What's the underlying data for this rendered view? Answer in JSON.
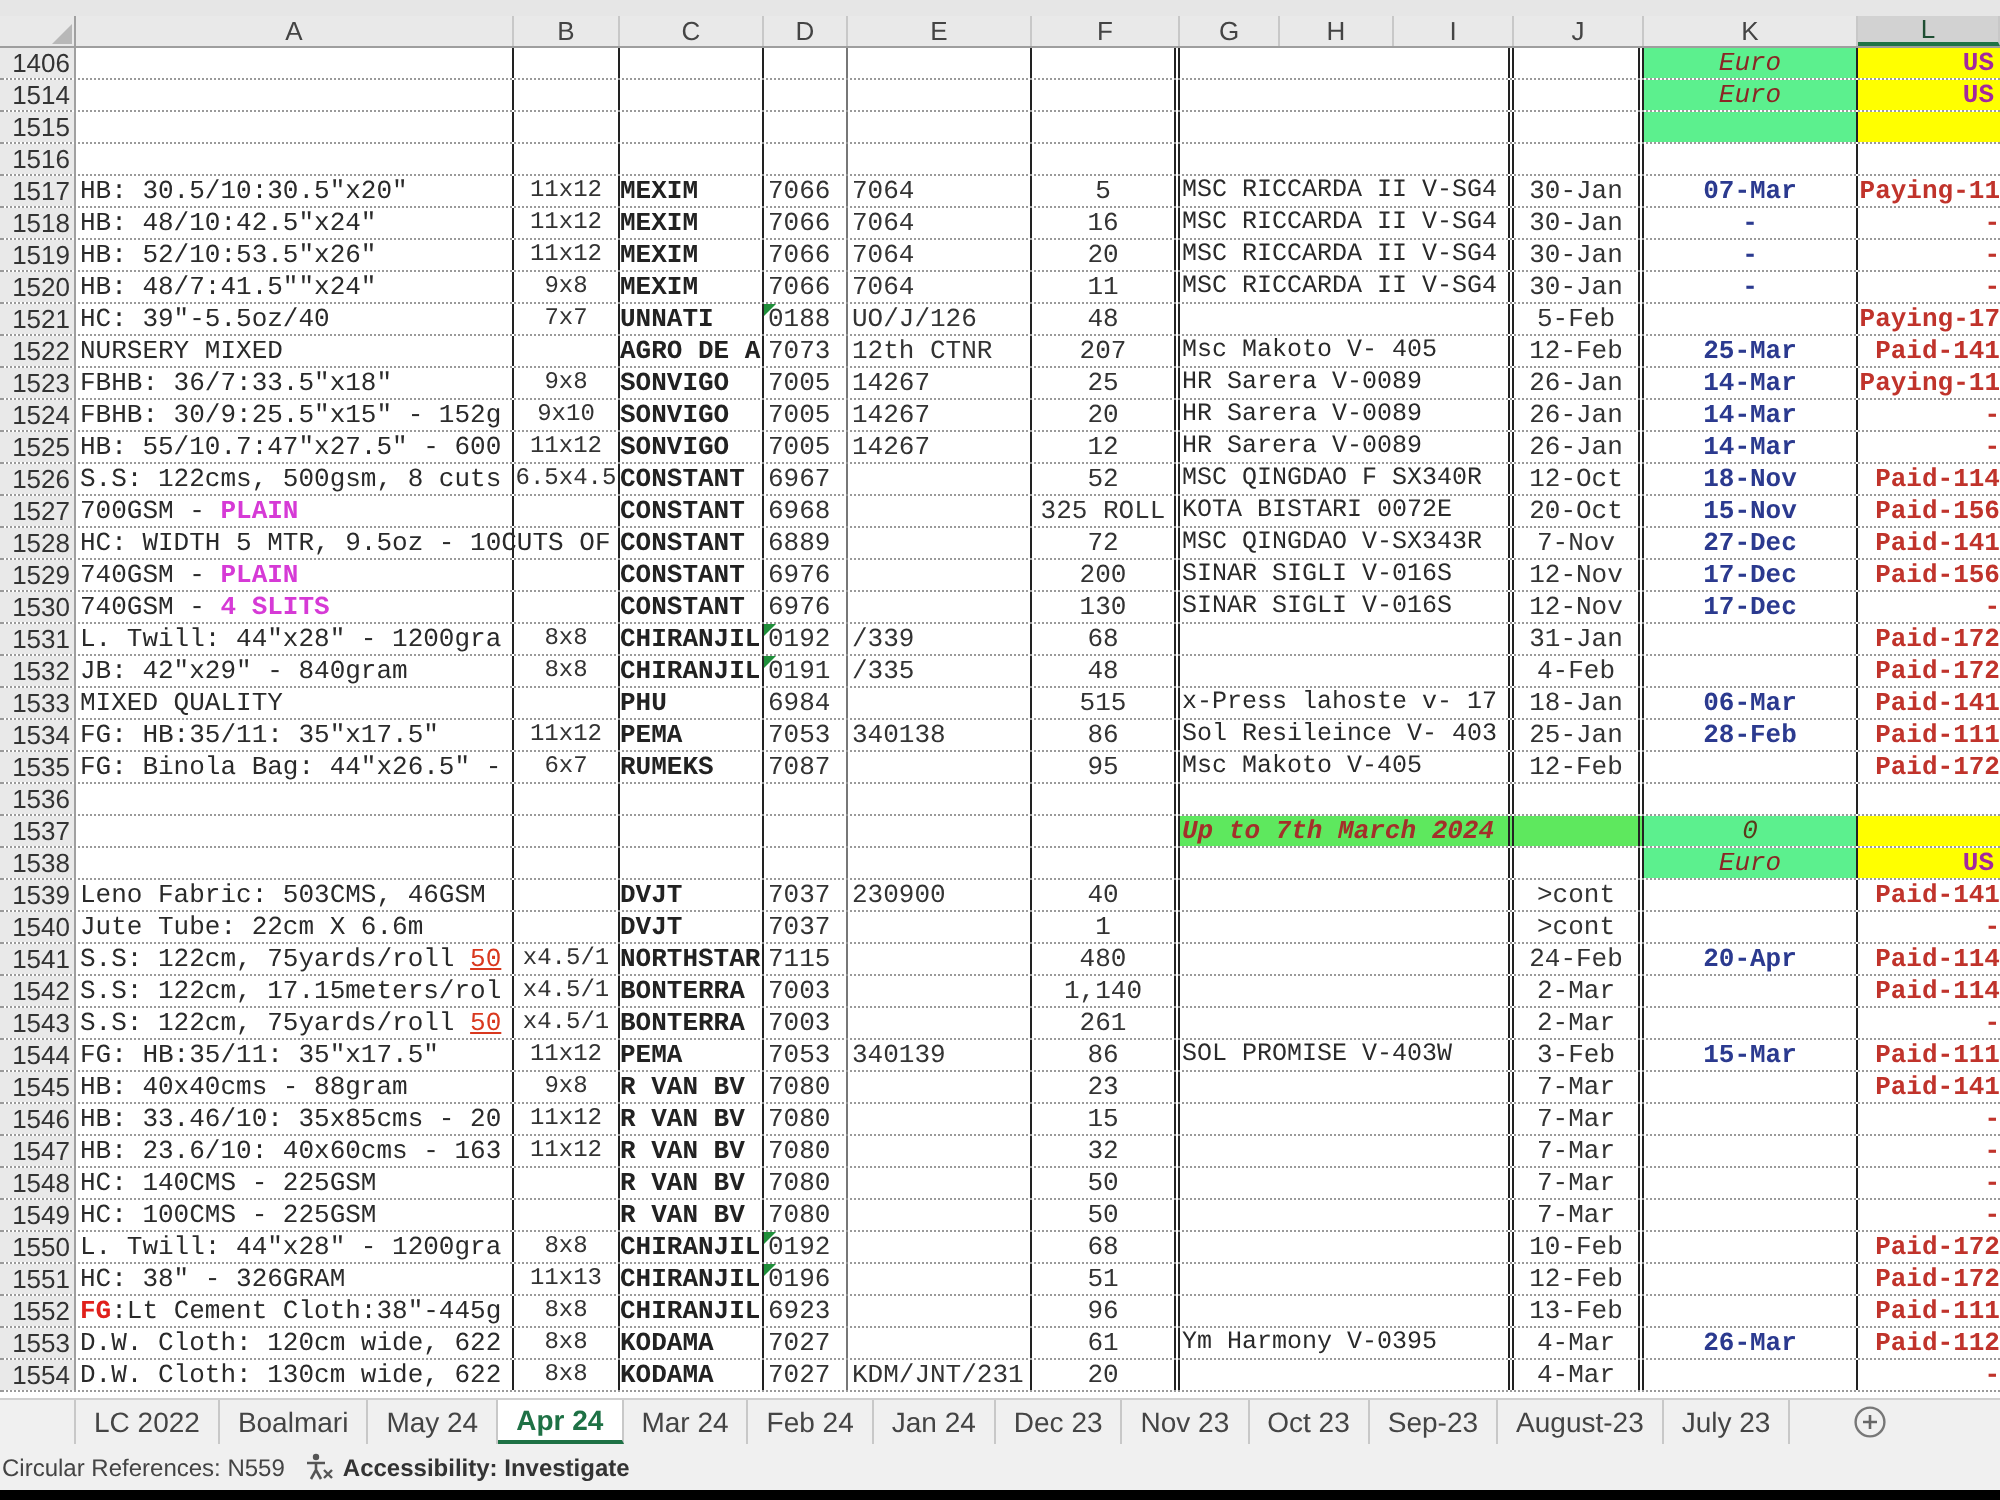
{
  "columns": [
    {
      "label": "A",
      "selected": false
    },
    {
      "label": "B",
      "selected": false
    },
    {
      "label": "C",
      "selected": false
    },
    {
      "label": "D",
      "selected": false
    },
    {
      "label": "E",
      "selected": false
    },
    {
      "label": "F",
      "selected": false
    },
    {
      "label": "G",
      "selected": false
    },
    {
      "label": "H",
      "selected": false
    },
    {
      "label": "I",
      "selected": false
    },
    {
      "label": "J",
      "selected": false
    },
    {
      "label": "K",
      "selected": false
    },
    {
      "label": "L",
      "selected": true
    }
  ],
  "rows": [
    {
      "number": "1406",
      "kind": "currency",
      "d_marked": false,
      "k": "Euro",
      "l": "US"
    },
    {
      "number": "1514",
      "kind": "currency",
      "d_marked": false,
      "k": "Euro",
      "l": "US"
    },
    {
      "number": "1515",
      "kind": "currency",
      "d_marked": false
    },
    {
      "number": "1516",
      "kind": "data",
      "d_marked": false
    },
    {
      "number": "1517",
      "kind": "data",
      "d_marked": false,
      "a": "HB: 30.5/10:30.5\"x20\"",
      "b": "11x12",
      "c": "MEXIM",
      "d": "7066",
      "e": "7064",
      "f": "5",
      "g": "MSC RICCARDA II V-SG4",
      "j": "30-Jan",
      "k": "07-Mar",
      "l": "Paying-11"
    },
    {
      "number": "1518",
      "kind": "data",
      "d_marked": false,
      "a": "HB: 48/10:42.5\"x24\"",
      "b": "11x12",
      "c": "MEXIM",
      "d": "7066",
      "e": "7064",
      "f": "16",
      "g": "MSC RICCARDA II V-SG4",
      "j": "30-Jan",
      "k": "-",
      "l": "-"
    },
    {
      "number": "1519",
      "kind": "data",
      "d_marked": false,
      "a": "HB: 52/10:53.5\"x26\"",
      "b": "11x12",
      "c": "MEXIM",
      "d": "7066",
      "e": "7064",
      "f": "20",
      "g": "MSC RICCARDA II V-SG4",
      "j": "30-Jan",
      "k": "-",
      "l": "-"
    },
    {
      "number": "1520",
      "kind": "data",
      "d_marked": false,
      "a": "HB: 48/7:41.5\"\"x24\"",
      "b": "9x8",
      "c": "MEXIM",
      "d": "7066",
      "e": "7064",
      "f": "11",
      "g": "MSC RICCARDA II V-SG4",
      "j": "30-Jan",
      "k": "-",
      "l": "-"
    },
    {
      "number": "1521",
      "kind": "data",
      "d_marked": true,
      "a": "HC: 39\"-5.5oz/40",
      "b": "7x7",
      "c": "UNNATI",
      "d": "0188",
      "e": "UO/J/126",
      "f": "48",
      "j": "5-Feb",
      "l": "Paying-17"
    },
    {
      "number": "1522",
      "kind": "data",
      "d_marked": false,
      "a": "NURSERY MIXED",
      "c": "AGRO DE A",
      "d": "7073",
      "e": "12th CTNR",
      "f": "207",
      "g": "Msc Makoto V- 405",
      "j": "12-Feb",
      "k": "25-Mar",
      "l": "Paid-141"
    },
    {
      "number": "1523",
      "kind": "data",
      "d_marked": false,
      "a": "FBHB: 36/7:33.5\"x18\"",
      "b": "9x8",
      "c": "SONVIGO",
      "d": "7005",
      "e": "14267",
      "f": "25",
      "g": "HR Sarera V-0089",
      "j": "26-Jan",
      "k": "14-Mar",
      "l": "Paying-11"
    },
    {
      "number": "1524",
      "kind": "data",
      "d_marked": false,
      "a": "FBHB: 30/9:25.5\"x15\" - 152g",
      "b": "9x10",
      "c": "SONVIGO",
      "d": "7005",
      "e": "14267",
      "f": "20",
      "g": "HR Sarera V-0089",
      "j": "26-Jan",
      "k": "14-Mar",
      "l": "-"
    },
    {
      "number": "1525",
      "kind": "data",
      "d_marked": false,
      "a": "HB: 55/10.7:47\"x27.5\" - 600",
      "b": "11x12",
      "c": "SONVIGO",
      "d": "7005",
      "e": "14267",
      "f": "12",
      "g": "HR Sarera V-0089",
      "j": "26-Jan",
      "k": "14-Mar",
      "l": "-"
    },
    {
      "number": "1526",
      "kind": "data",
      "d_marked": false,
      "a": "S.S: 122cms, 500gsm, 8 cuts",
      "b": "6.5x4.5",
      "c": "CONSTANT",
      "d": "6967",
      "f": "52",
      "g": "MSC QINGDAO F SX340R",
      "j": "12-Oct",
      "k": "18-Nov",
      "l": "Paid-114"
    },
    {
      "number": "1527",
      "kind": "data",
      "d_marked": false,
      "a": [
        {
          "text": "700GSM - ",
          "kind": "plain"
        },
        {
          "text": "PLAIN",
          "kind": "highlight"
        }
      ],
      "c": "CONSTANT",
      "d": "6968",
      "f": "325 ROLL",
      "g": "KOTA BISTARI 0072E",
      "j": "20-Oct",
      "k": "15-Nov",
      "l": "Paid-156"
    },
    {
      "number": "1528",
      "kind": "data",
      "d_marked": false,
      "a": "HC: WIDTH 5 MTR, 9.5oz - 10CUTS OF",
      "c": "CONSTANT",
      "d": "6889",
      "f": "72",
      "g": "MSC QINGDAO V-SX343R",
      "j": "7-Nov",
      "k": "27-Dec",
      "l": "Paid-141"
    },
    {
      "number": "1529",
      "kind": "data",
      "d_marked": false,
      "a": [
        {
          "text": "740GSM - ",
          "kind": "plain"
        },
        {
          "text": "PLAIN",
          "kind": "highlight"
        }
      ],
      "c": "CONSTANT",
      "d": "6976",
      "f": "200",
      "g": "SINAR SIGLI V-016S",
      "j": "12-Nov",
      "k": "17-Dec",
      "l": "Paid-156"
    },
    {
      "number": "1530",
      "kind": "data",
      "d_marked": false,
      "a": [
        {
          "text": "740GSM - ",
          "kind": "plain"
        },
        {
          "text": "4 SLITS",
          "kind": "highlight"
        }
      ],
      "c": "CONSTANT",
      "d": "6976",
      "f": "130",
      "g": "SINAR SIGLI V-016S",
      "j": "12-Nov",
      "k": "17-Dec",
      "l": "-"
    },
    {
      "number": "1531",
      "kind": "data",
      "d_marked": true,
      "a": "L. Twill: 44\"x28\" - 1200gra",
      "b": "8x8",
      "c": "CHIRANJIL",
      "d": "0192",
      "e": "/339",
      "f": "68",
      "j": "31-Jan",
      "l": "Paid-172"
    },
    {
      "number": "1532",
      "kind": "data",
      "d_marked": true,
      "a": "JB: 42\"x29\" - 840gram",
      "b": "8x8",
      "c": "CHIRANJIL",
      "d": "0191",
      "e": "/335",
      "f": "48",
      "j": "4-Feb",
      "l": "Paid-172"
    },
    {
      "number": "1533",
      "kind": "data",
      "d_marked": false,
      "a": "MIXED QUALITY",
      "c": "PHU",
      "d": "6984",
      "f": "515",
      "g": "x-Press lahoste v- 17",
      "j": "18-Jan",
      "k": "06-Mar",
      "l": "Paid-141"
    },
    {
      "number": "1534",
      "kind": "data",
      "d_marked": false,
      "a": "FG: HB:35/11: 35\"x17.5\"",
      "b": "11x12",
      "c": "PEMA",
      "d": "7053",
      "e": "340138",
      "f": "86",
      "g": "Sol Resileince V- 403",
      "j": "25-Jan",
      "k": "28-Feb",
      "l": "Paid-111"
    },
    {
      "number": "1535",
      "kind": "data",
      "d_marked": false,
      "a": "FG: Binola Bag: 44\"x26.5\" -",
      "b": "6x7",
      "c": "RUMEKS",
      "d": "7087",
      "f": "95",
      "g": "Msc Makoto V-405",
      "j": "12-Feb",
      "l": "Paid-172"
    },
    {
      "number": "1536",
      "kind": "data",
      "d_marked": false
    },
    {
      "number": "1537",
      "kind": "total",
      "d_marked": false,
      "g": "Up to 7th March 2024",
      "k": "0"
    },
    {
      "number": "1538",
      "kind": "currency",
      "d_marked": false,
      "k": "Euro",
      "l": "US"
    },
    {
      "number": "1539",
      "kind": "data",
      "d_marked": false,
      "a": "Leno Fabric: 503CMS, 46GSM",
      "c": "DVJT",
      "d": "7037",
      "e": "230900",
      "f": "40",
      "j": ">cont",
      "l": "Paid-141"
    },
    {
      "number": "1540",
      "kind": "data",
      "d_marked": false,
      "a": "Jute Tube: 22cm X 6.6m",
      "c": "DVJT",
      "d": "7037",
      "f": "1",
      "j": ">cont",
      "l": "-"
    },
    {
      "number": "1541",
      "kind": "data",
      "d_marked": false,
      "a": [
        {
          "text": "S.S: 122cm, 75yards/roll ",
          "kind": "plain"
        },
        {
          "text": "50",
          "kind": "alert"
        }
      ],
      "b": "x4.5/1",
      "c": "NORTHSTAR",
      "d": "7115",
      "f": "480",
      "j": "24-Feb",
      "k": "20-Apr",
      "l": "Paid-114"
    },
    {
      "number": "1542",
      "kind": "data",
      "d_marked": false,
      "a": "S.S: 122cm, 17.15meters/rol",
      "b": "x4.5/1",
      "c": "BONTERRA",
      "d": "7003",
      "f": "1,140",
      "j": "2-Mar",
      "l": "Paid-114"
    },
    {
      "number": "1543",
      "kind": "data",
      "d_marked": false,
      "a": [
        {
          "text": "S.S: 122cm, 75yards/roll ",
          "kind": "plain"
        },
        {
          "text": "50",
          "kind": "alert"
        }
      ],
      "b": "x4.5/1",
      "c": "BONTERRA",
      "d": "7003",
      "f": "261",
      "j": "2-Mar",
      "l": "-"
    },
    {
      "number": "1544",
      "kind": "data",
      "d_marked": false,
      "a": "FG: HB:35/11: 35\"x17.5\"",
      "b": "11x12",
      "c": "PEMA",
      "d": "7053",
      "e": "340139",
      "f": "86",
      "g": "SOL PROMISE V-403W",
      "j": "3-Feb",
      "k": "15-Mar",
      "l": "Paid-111"
    },
    {
      "number": "1545",
      "kind": "data",
      "d_marked": false,
      "a": "HB: 40x40cms - 88gram",
      "b": "9x8",
      "c": "R VAN BV",
      "d": "7080",
      "f": "23",
      "j": "7-Mar",
      "l": "Paid-141"
    },
    {
      "number": "1546",
      "kind": "data",
      "d_marked": false,
      "a": "HB: 33.46/10: 35x85cms - 20",
      "b": "11x12",
      "c": "R VAN BV",
      "d": "7080",
      "f": "15",
      "j": "7-Mar",
      "l": "-"
    },
    {
      "number": "1547",
      "kind": "data",
      "d_marked": false,
      "a": "HB: 23.6/10: 40x60cms - 163",
      "b": "11x12",
      "c": "R VAN BV",
      "d": "7080",
      "f": "32",
      "j": "7-Mar",
      "l": "-"
    },
    {
      "number": "1548",
      "kind": "data",
      "d_marked": false,
      "a": "HC: 140CMS - 225GSM",
      "c": "R VAN BV",
      "d": "7080",
      "f": "50",
      "j": "7-Mar",
      "l": "-"
    },
    {
      "number": "1549",
      "kind": "data",
      "d_marked": false,
      "a": "HC: 100CMS - 225GSM",
      "c": "R VAN BV",
      "d": "7080",
      "f": "50",
      "j": "7-Mar",
      "l": "-"
    },
    {
      "number": "1550",
      "kind": "data",
      "d_marked": true,
      "a": "L. Twill: 44\"x28\" - 1200gra",
      "b": "8x8",
      "c": "CHIRANJIL",
      "d": "0192",
      "f": "68",
      "j": "10-Feb",
      "l": "Paid-172"
    },
    {
      "number": "1551",
      "kind": "data",
      "d_marked": true,
      "a": "HC: 38\" - 326GRAM",
      "b": "11x13",
      "c": "CHIRANJIL",
      "d": "0196",
      "f": "51",
      "j": "12-Feb",
      "l": "Paid-172"
    },
    {
      "number": "1552",
      "kind": "data",
      "d_marked": false,
      "a": [
        {
          "text": "FG",
          "kind": "flag"
        },
        {
          "text": ":Lt Cement Cloth:38\"-445g",
          "kind": "plain"
        }
      ],
      "b": "8x8",
      "c": "CHIRANJIL",
      "d": "6923",
      "f": "96",
      "j": "13-Feb",
      "l": "Paid-111"
    },
    {
      "number": "1553",
      "kind": "data",
      "d_marked": false,
      "a": "D.W. Cloth: 120cm wide, 622",
      "b": "8x8",
      "c": "KODAMA",
      "d": "7027",
      "f": "61",
      "g": "Ym Harmony V-0395",
      "j": "4-Mar",
      "k": "26-Mar",
      "l": "Paid-112"
    },
    {
      "number": "1554",
      "kind": "data",
      "d_marked": false,
      "a": "D.W. Cloth: 130cm wide, 622",
      "b": "8x8",
      "c": "KODAMA",
      "d": "7027",
      "e": "KDM/JNT/231",
      "f": "20",
      "j": "4-Mar",
      "l": "-"
    }
  ],
  "tabs": [
    {
      "label": "LC 2022",
      "selected": false
    },
    {
      "label": "Boalmari",
      "selected": false
    },
    {
      "label": "May 24",
      "selected": false
    },
    {
      "label": "Apr 24",
      "selected": true
    },
    {
      "label": "Mar 24",
      "selected": false
    },
    {
      "label": "Feb 24",
      "selected": false
    },
    {
      "label": "Jan 24",
      "selected": false
    },
    {
      "label": "Dec 23",
      "selected": false
    },
    {
      "label": "Nov 23",
      "selected": false
    },
    {
      "label": "Oct 23",
      "selected": false
    },
    {
      "label": "Sep-23",
      "selected": false
    },
    {
      "label": "August-23",
      "selected": false
    },
    {
      "label": "July 23",
      "selected": false
    }
  ],
  "status_bar": {
    "circular_references": "Circular References: N559",
    "accessibility": "Accessibility: Investigate"
  }
}
